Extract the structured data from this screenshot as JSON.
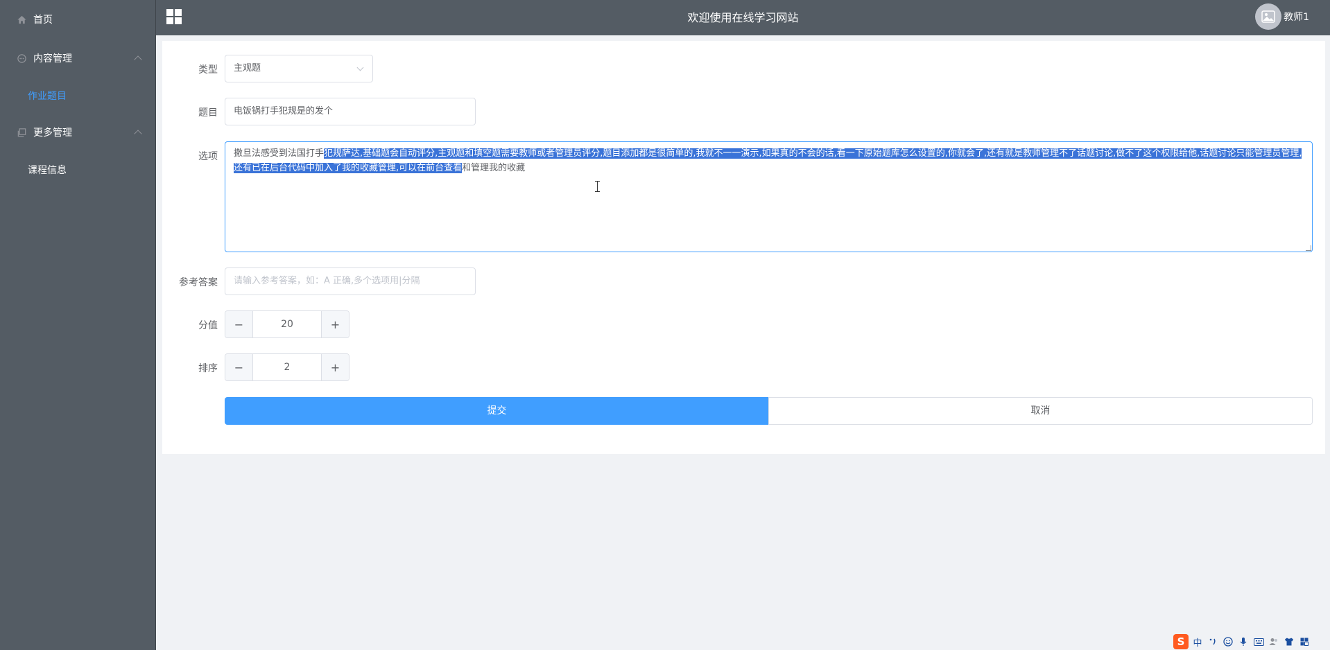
{
  "sidebar": {
    "home": "首页",
    "content_mgmt": "内容管理",
    "homework": "作业题目",
    "more_mgmt": "更多管理",
    "course_info": "课程信息"
  },
  "header": {
    "title": "欢迎使用在线学习网站",
    "user": "教师1"
  },
  "form": {
    "type_label": "类型",
    "type_value": "主观题",
    "question_label": "题目",
    "question_value": "电饭锅打手犯规是的发个",
    "options_label": "选项",
    "options_text_pre": "撒旦法感受到法国打手",
    "options_text_selected": "犯规萨达,基础题会自动评分,主观题和填空题需要教师或者管理员评分,题目添加都是很简单的,我就不一一演示,如果真的不会的话,看一下原始题库怎么设置的,你就会了,还有就是教师管理不了话题讨论,做不了这个权限给他,话题讨论只能管理员管理,还有已在后台代码中加入了我的收藏管理,可以在前台查看",
    "options_text_post": "和管理我的收藏",
    "answer_label": "参考答案",
    "answer_placeholder": "请输入参考答案，如：A 正确,多个选项用|分隔",
    "score_label": "分值",
    "score_value": "20",
    "order_label": "排序",
    "order_value": "2",
    "submit_label": "提交",
    "cancel_label": "取消"
  },
  "ime": {
    "logo": "S",
    "lang": "中"
  },
  "colors": {
    "sidebar_bg": "#545c64",
    "primary": "#409eff",
    "selection": "#3a73d8"
  }
}
